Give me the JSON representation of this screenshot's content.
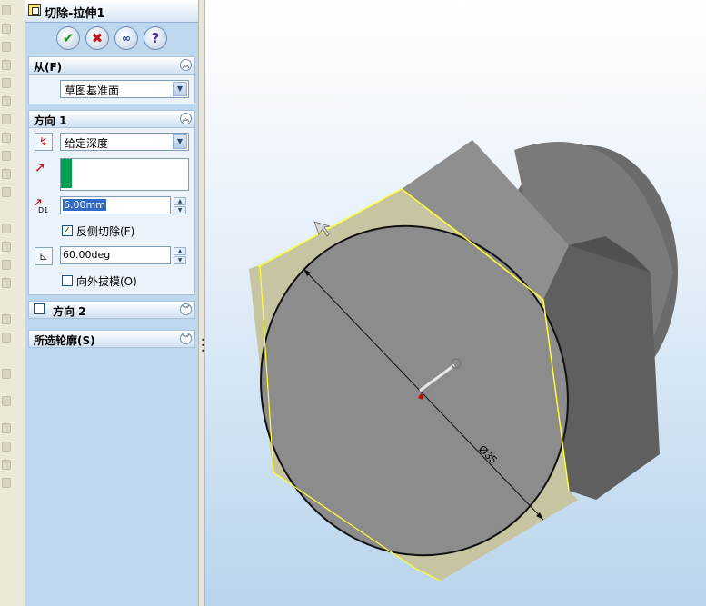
{
  "panel": {
    "title": "切除-拉伸1",
    "buttons": {
      "ok_icon": "green-check-icon",
      "cancel_icon": "red-x-icon",
      "preview_icon": "glasses-icon",
      "help_label": "?"
    },
    "from_group": {
      "header": "从(F)",
      "selected_option": "草图基准面"
    },
    "direction1": {
      "header": "方向 1",
      "end_condition": "给定深度",
      "depth_value": "6.00mm",
      "depth_label": "D1",
      "flip_side_label": "反侧切除(F)",
      "flip_side_checked": true,
      "draft_angle": "60.00deg",
      "draft_outward_label": "向外拔模(O)",
      "draft_outward_checked": false
    },
    "direction2": {
      "header": "方向 2",
      "enabled": false
    },
    "selected_contours": {
      "header": "所选轮廓(S)"
    }
  },
  "viewport": {
    "dimension_label": "Ø35",
    "colors": {
      "part_gray": "#8c8c8c",
      "chamfer_face": "#c6c4a1",
      "edge_highlight": "#ffff33"
    }
  }
}
